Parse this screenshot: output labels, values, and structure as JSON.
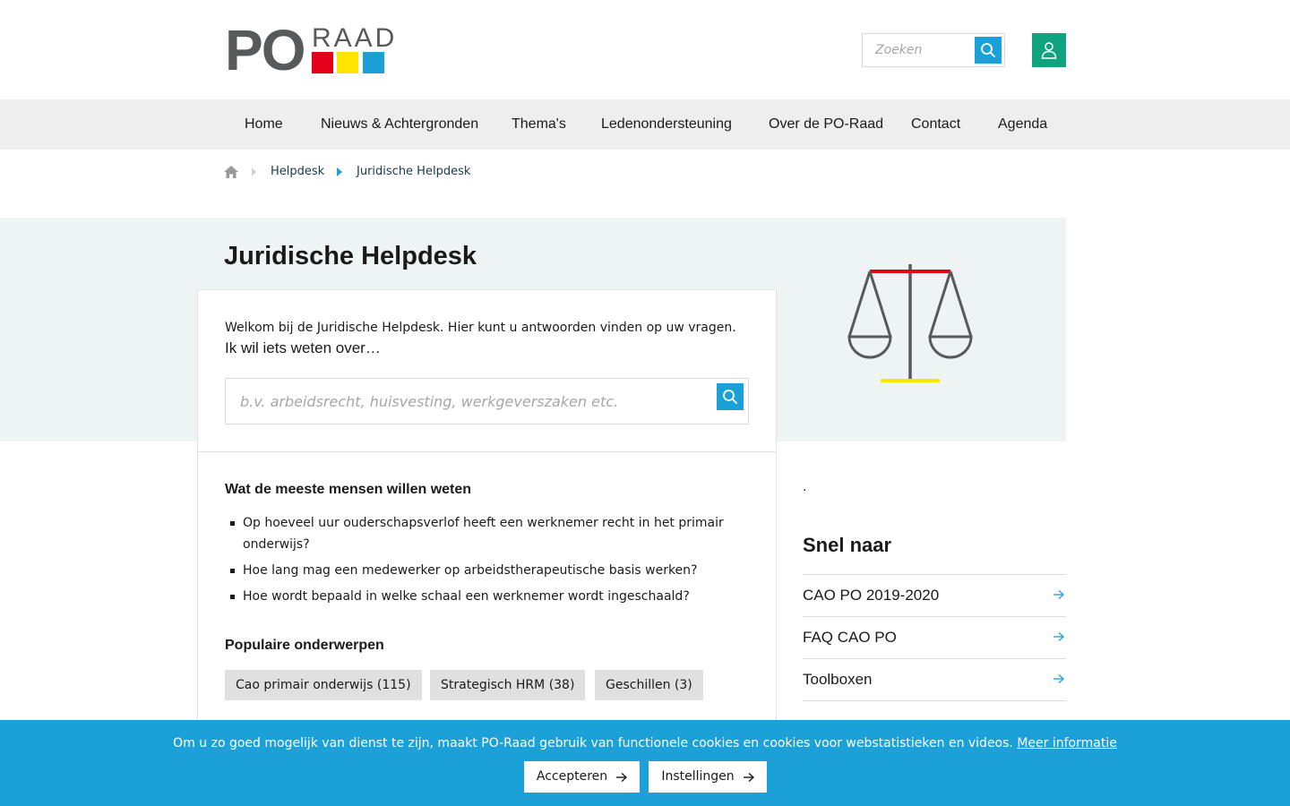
{
  "brand": {
    "logo_po": "PO",
    "logo_raad": "RAAD",
    "colors": {
      "red": "#e2001a",
      "yellow": "#ffe500",
      "blue": "#1ba1d7",
      "green": "#10a37f",
      "logo_gray": "#58595b"
    }
  },
  "header": {
    "search_placeholder": "Zoeken",
    "search_icon": "search-icon",
    "user_icon": "user-icon"
  },
  "nav": {
    "items": [
      {
        "label": "Home"
      },
      {
        "label": "Nieuws & Achtergronden"
      },
      {
        "label": "Thema's"
      },
      {
        "label": "Ledenondersteuning"
      },
      {
        "label": "Over de PO-Raad"
      },
      {
        "label": "Contact"
      },
      {
        "label": "Agenda"
      }
    ]
  },
  "breadcrumb": {
    "home_icon": "home-icon",
    "items": [
      {
        "label": "Helpdesk"
      },
      {
        "label": "Juridische Helpdesk"
      }
    ]
  },
  "page": {
    "title": "Juridische Helpdesk",
    "welcome": "Welkom bij de Juridische Helpdesk. Hier kunt u antwoorden vinden op uw vragen.",
    "ask": "Ik wil iets weten over…",
    "search_placeholder": "b.v. arbeidsrecht, huisvesting, werkgeverszaken etc.",
    "illustration_icon": "scales-of-justice-icon"
  },
  "faq": {
    "title": "Wat de meeste mensen willen weten",
    "items": [
      "Op hoeveel uur ouderschapsverlof heeft een werknemer recht in het primair onderwijs?",
      "Hoe lang mag een medewerker op arbeidstherapeutische basis werken?",
      "Hoe wordt bepaald in welke schaal een werknemer wordt ingeschaald?"
    ]
  },
  "topics": {
    "title": "Populaire onderwerpen",
    "tags": [
      "Cao primair onderwijs (115)",
      "Strategisch HRM (38)",
      "Geschillen (3)"
    ]
  },
  "sidebar": {
    "dot": ".",
    "quick_title": "Snel naar",
    "links": [
      {
        "label": "CAO PO 2019-2020"
      },
      {
        "label": "FAQ CAO PO"
      },
      {
        "label": "Toolboxen"
      }
    ]
  },
  "cookie": {
    "text": "Om u zo goed mogelijk van dienst te zijn, maakt PO-Raad gebruik van functionele cookies en cookies voor webstatistieken en videos.",
    "more_link": "Meer informatie",
    "accept": "Accepteren",
    "settings": "Instellingen"
  }
}
